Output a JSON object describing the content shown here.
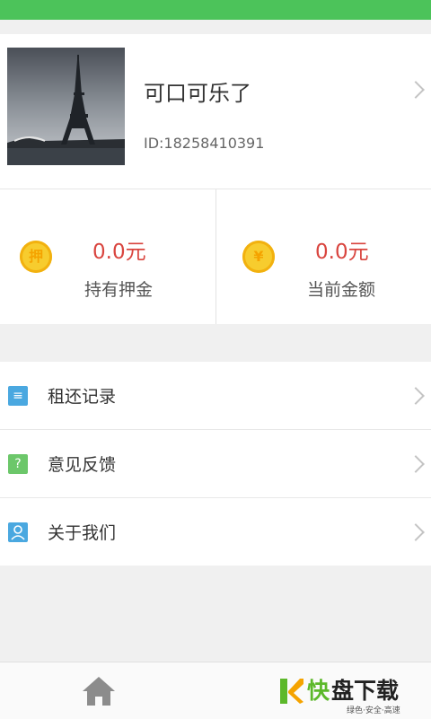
{
  "profile": {
    "name": "可口可乐了",
    "id_text": "ID:18258410391"
  },
  "stats": [
    {
      "amount": "0.0元",
      "label": "持有押金",
      "icon_char": "押",
      "icon": "deposit-coin-icon"
    },
    {
      "amount": "0.0元",
      "label": "当前金额",
      "icon_char": "¥",
      "icon": "yen-coin-icon"
    }
  ],
  "menu": [
    {
      "label": "租还记录",
      "icon": "list-icon",
      "icon_char": "≡",
      "color": "#4aa8e0"
    },
    {
      "label": "意见反馈",
      "icon": "question-icon",
      "icon_char": "?",
      "color": "#6cc76a"
    },
    {
      "label": "关于我们",
      "icon": "person-icon",
      "icon_char": "",
      "color": "#4aa8e0"
    }
  ],
  "watermark": {
    "brand_green": "快",
    "brand_rest": "盘下载",
    "tagline": "绿色·安全·高速"
  },
  "colors": {
    "top_bar": "#4cc35a",
    "amount": "#d9453f",
    "coin": "#f7cc2e",
    "watermark_green": "#5cb82a"
  }
}
